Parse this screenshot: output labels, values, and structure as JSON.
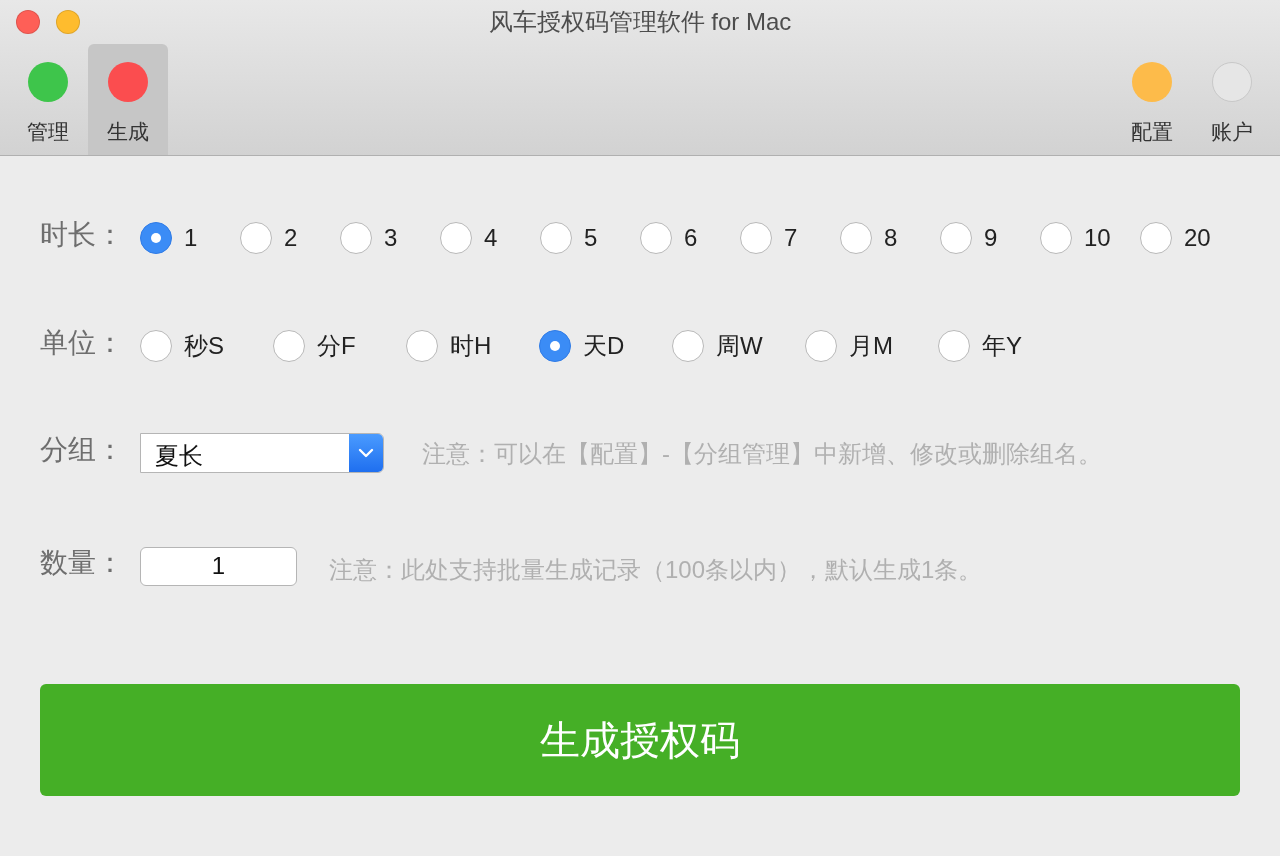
{
  "window": {
    "title": "风车授权码管理软件 for Mac",
    "controls": [
      {
        "kind": "close",
        "color": "#fe5f57"
      },
      {
        "kind": "minimize",
        "color": "#febc2e"
      }
    ]
  },
  "toolbar": {
    "left": [
      {
        "label": "管理",
        "color": "#3ec54b",
        "selected": false
      },
      {
        "label": "生成",
        "color": "#fb4d4f",
        "selected": true
      }
    ],
    "right": [
      {
        "label": "配置",
        "color": "#fdbb4a",
        "selected": false
      },
      {
        "label": "账户",
        "color": "#e6e6e6",
        "selected": false
      }
    ]
  },
  "duration": {
    "label": "时长：",
    "options": [
      {
        "label": "1",
        "selected": true
      },
      {
        "label": "2",
        "selected": false
      },
      {
        "label": "3",
        "selected": false
      },
      {
        "label": "4",
        "selected": false
      },
      {
        "label": "5",
        "selected": false
      },
      {
        "label": "6",
        "selected": false
      },
      {
        "label": "7",
        "selected": false
      },
      {
        "label": "8",
        "selected": false
      },
      {
        "label": "9",
        "selected": false
      },
      {
        "label": "10",
        "selected": false
      },
      {
        "label": "20",
        "selected": false
      }
    ]
  },
  "unit": {
    "label": "单位：",
    "options": [
      {
        "label": "秒S",
        "selected": false
      },
      {
        "label": "分F",
        "selected": false
      },
      {
        "label": "时H",
        "selected": false
      },
      {
        "label": "天D",
        "selected": true
      },
      {
        "label": "周W",
        "selected": false
      },
      {
        "label": "月M",
        "selected": false
      },
      {
        "label": "年Y",
        "selected": false
      }
    ]
  },
  "group": {
    "label": "分组：",
    "value": "夏长",
    "note": "注意：可以在【配置】-【分组管理】中新增、修改或删除组名。"
  },
  "count": {
    "label": "数量：",
    "value": "1",
    "note": "注意：此处支持批量生成记录（100条以内），默认生成1条。"
  },
  "generate_button": "生成授权码"
}
